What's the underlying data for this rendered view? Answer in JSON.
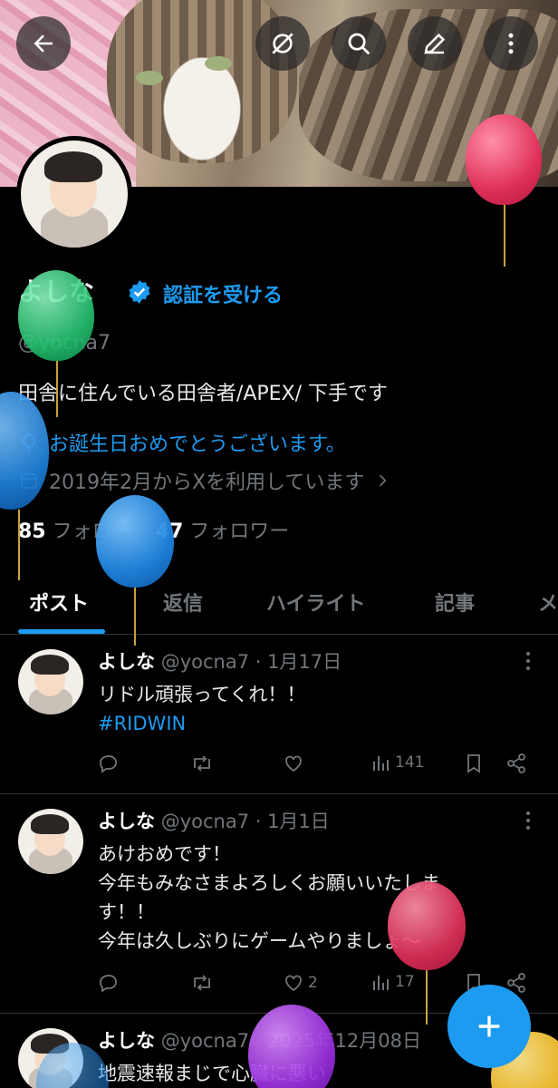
{
  "profile": {
    "name": "よしな",
    "verify_label": "認証を受ける",
    "handle": "@yocna7",
    "bio": "田舎に住んでいる田舎者/APEX/ 下手です",
    "birthday": "お誕生日おめでとうございます。",
    "joined": "2019年2月からXを利用しています",
    "following_count": "85",
    "following_label": "フォロー",
    "followers_count": "47",
    "followers_label": "フォロワー"
  },
  "tabs": [
    "ポスト",
    "返信",
    "ハイライト",
    "記事",
    "メ"
  ],
  "posts": [
    {
      "name": "よしな",
      "meta": "@yocna7 · 1月17日",
      "lines": [
        "リドル頑張ってくれ！！"
      ],
      "hashtag": "#RIDWIN",
      "likes": "",
      "views": "141"
    },
    {
      "name": "よしな",
      "meta": "@yocna7 · 1月1日",
      "lines": [
        "あけおめです！",
        "今年もみなさまよろしくお願いいたしま",
        "す！！",
        "今年は久しぶりにゲームやりましょ～"
      ],
      "hashtag": "",
      "likes": "2",
      "views": "17"
    },
    {
      "name": "よしな",
      "meta": "@yocna7 · 2025年12月08日",
      "lines": [
        "地震速報まじで心臓に悪い"
      ],
      "hashtag": "",
      "likes": "",
      "views": ""
    }
  ],
  "colors": {
    "accent": "#1d9bf0",
    "background": "#000000",
    "muted": "#71767b"
  },
  "icons": {
    "back": "arrow-left-icon",
    "hide": "eye-slash-icon",
    "search": "search-icon",
    "edit": "pencil-icon",
    "more": "more-vertical-icon",
    "fab": "plus-icon"
  }
}
